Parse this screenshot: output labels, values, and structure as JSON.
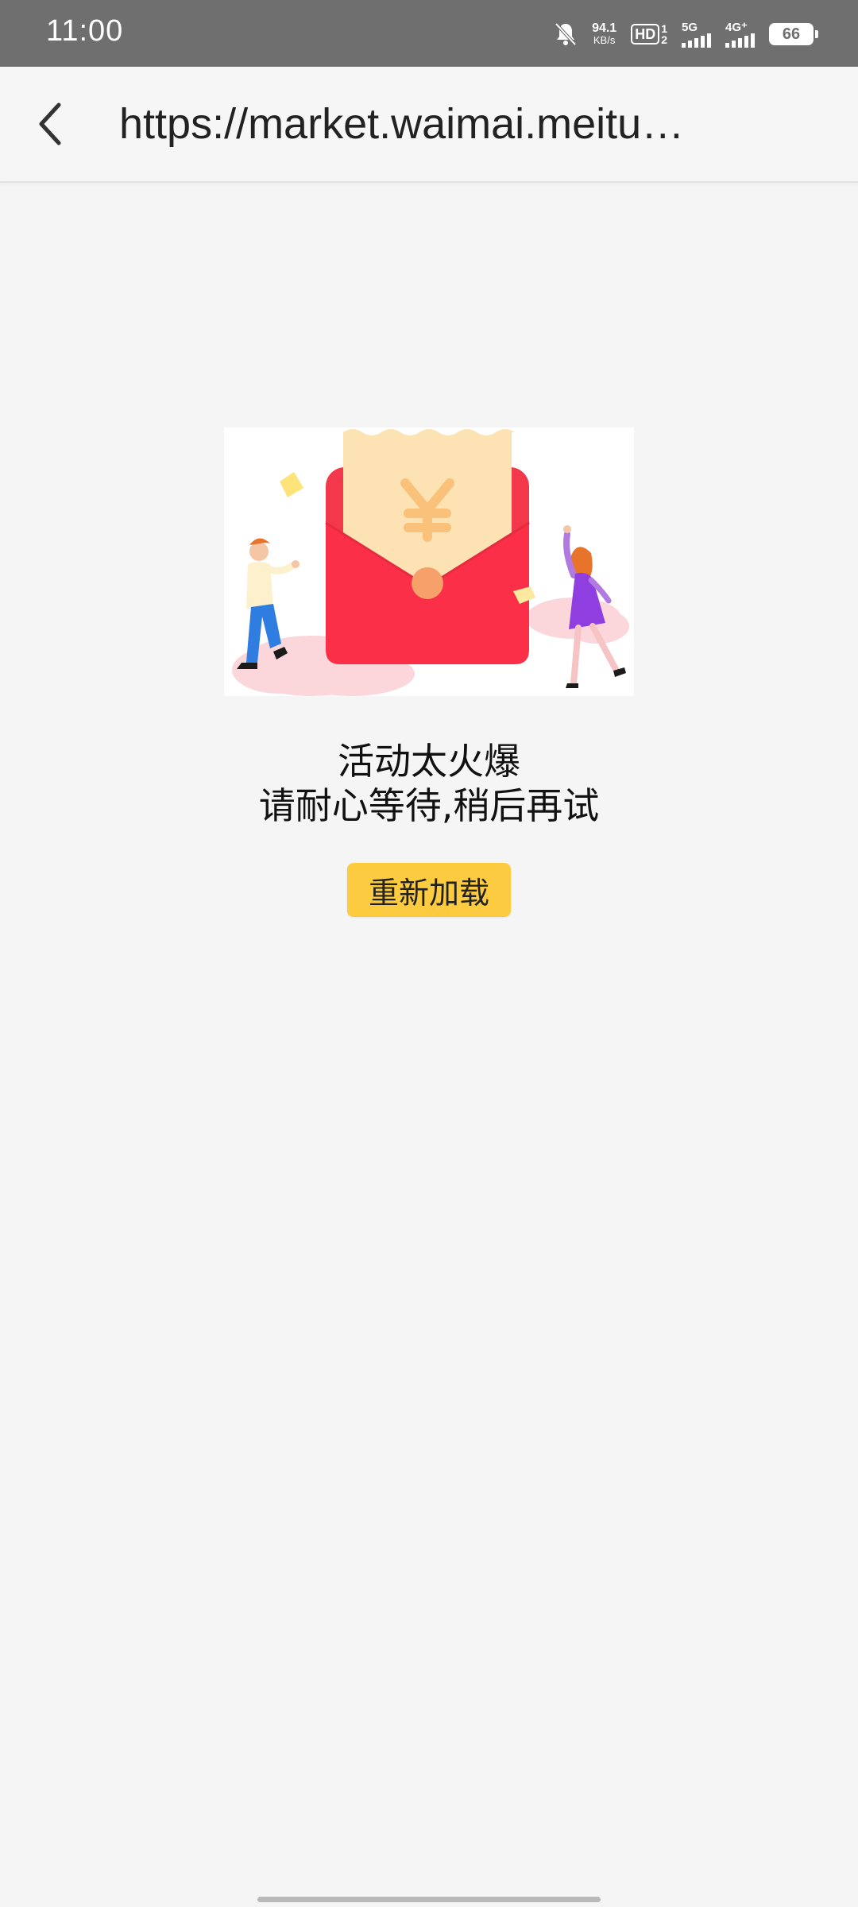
{
  "status_bar": {
    "time": "11:00",
    "net_speed_value": "94.1",
    "net_speed_unit": "KB/s",
    "hd_label": "HD",
    "hd_sub_top": "1",
    "hd_sub_bottom": "2",
    "sim1_label": "5G",
    "sim2_label": "4G⁺",
    "battery_level": "66",
    "icons": [
      "bell-muted-icon",
      "hd-icon",
      "signal-5g-icon",
      "signal-4g-icon",
      "battery-icon"
    ]
  },
  "nav": {
    "back_icon": "chevron-left-icon",
    "url": "https://market.waimai.meitu…"
  },
  "content": {
    "title": "活动太火爆",
    "subtitle": "请耐心等待,稍后再试",
    "reload_button": "重新加载"
  },
  "colors": {
    "status_bar_bg": "#6f6f6f",
    "page_bg": "#f5f5f5",
    "button_bg": "#fdcb3f",
    "envelope_red": "#f2384a",
    "envelope_inner": "#fde2b4"
  }
}
